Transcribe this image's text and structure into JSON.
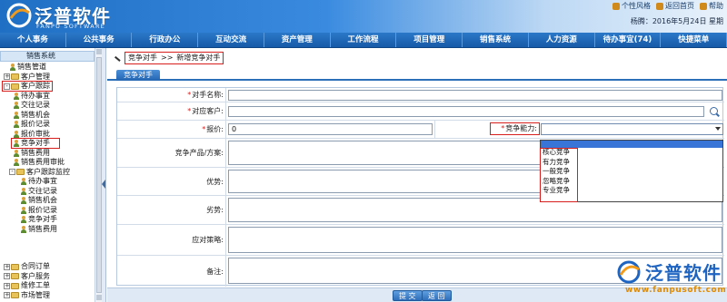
{
  "header": {
    "brand_cn": "泛普软件",
    "brand_en": "FANPU SOFTWARE",
    "top_links": [
      "个性风格",
      "返回首页",
      "帮助"
    ],
    "user_line": "杨腾：2016年5月24日 星期"
  },
  "nav": [
    "个人事务",
    "公共事务",
    "行政办公",
    "互动交流",
    "资产管理",
    "工作流程",
    "项目管理",
    "销售系统",
    "人力资源",
    "待办事宜(74)",
    "快捷菜单"
  ],
  "sidebar": {
    "title": "销售系统",
    "items": [
      {
        "label": "销售管道",
        "type": "person"
      },
      {
        "label": "客户管理",
        "type": "folder"
      },
      {
        "label": "客户跟踪",
        "type": "folder"
      },
      {
        "label": "待办事宜",
        "type": "person"
      },
      {
        "label": "交往记录",
        "type": "person"
      },
      {
        "label": "销售机会",
        "type": "person"
      },
      {
        "label": "报价记录",
        "type": "person"
      },
      {
        "label": "报价审批",
        "type": "person"
      },
      {
        "label": "竞争对手",
        "type": "person"
      },
      {
        "label": "销售费用",
        "type": "person"
      },
      {
        "label": "销售费用审批",
        "type": "person"
      },
      {
        "label": "客户跟踪监控",
        "type": "folder"
      },
      {
        "label": "待办事宜",
        "type": "person"
      },
      {
        "label": "交往记录",
        "type": "person"
      },
      {
        "label": "销售机会",
        "type": "person"
      },
      {
        "label": "报价记录",
        "type": "person"
      },
      {
        "label": "竞争对手",
        "type": "person"
      },
      {
        "label": "销售费用",
        "type": "person"
      },
      {
        "label": "合同订单",
        "type": "folder"
      },
      {
        "label": "客户服务",
        "type": "folder"
      },
      {
        "label": "维修工单",
        "type": "folder"
      },
      {
        "label": "市场管理",
        "type": "folder"
      }
    ]
  },
  "breadcrumb": {
    "part1": "竞争对手",
    "sep": ">>",
    "part2": "新增竞争对手"
  },
  "tab": "竞争对手",
  "form": {
    "name_label": "对手名称:",
    "customer_label": "对应客户:",
    "price_label": "报价:",
    "price_value": "0",
    "ability_label": "竞争能力:",
    "product_label": "竞争产品/方案:",
    "strength_label": "优势:",
    "weakness_label": "劣势:",
    "strategy_label": "应对策略:",
    "note_label": "备注:",
    "required_mark": "*"
  },
  "dropdown_options": [
    "核心竞争",
    "有力竞争",
    "一般竞争",
    "忽略竞争",
    "专业竞争"
  ],
  "buttons": {
    "submit": "提 交",
    "back": "返 回"
  },
  "watermark": {
    "text": "泛普软件",
    "url": "www.fanpusoft.com"
  }
}
